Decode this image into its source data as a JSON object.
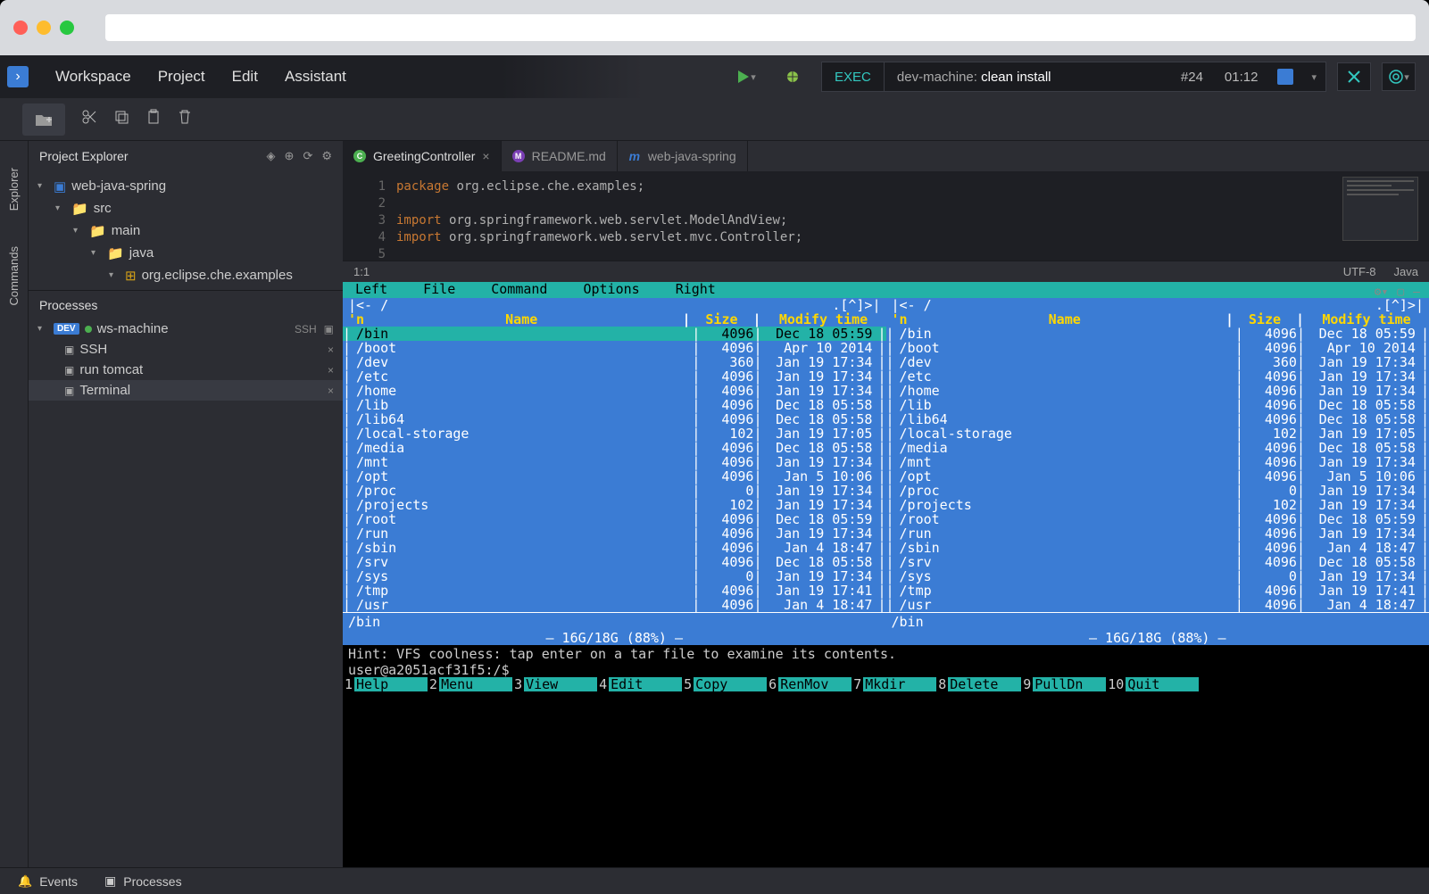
{
  "menus": {
    "workspace": "Workspace",
    "project": "Project",
    "edit": "Edit",
    "assistant": "Assistant"
  },
  "exec": {
    "label": "EXEC",
    "prefix": "dev-machine: ",
    "cmd": "clean install",
    "job": "#24",
    "time": "01:12"
  },
  "explorer": {
    "title": "Project Explorer",
    "root": "web-java-spring",
    "nodes": {
      "src": "src",
      "main": "main",
      "java": "java",
      "pkg": "org.eclipse.che.examples"
    }
  },
  "rail": {
    "explorer": "Explorer",
    "commands": "Commands"
  },
  "processes": {
    "title": "Processes",
    "machine": "ws-machine",
    "ssh_label": "SSH",
    "items": {
      "ssh": "SSH",
      "tomcat": "run tomcat",
      "terminal": "Terminal"
    }
  },
  "tabs": {
    "greeting": "GreetingController",
    "readme": "README.md",
    "spring": "web-java-spring"
  },
  "code": {
    "lines": [
      "1",
      "2",
      "3",
      "4",
      "5"
    ],
    "l1_kw": "package",
    "l1_rest": " org.eclipse.che.examples;",
    "l3_kw": "import",
    "l3_rest": " org.springframework.web.servlet.ModelAndView;",
    "l4_kw": "import",
    "l4_rest": " org.springframework.web.servlet.mvc.Controller;"
  },
  "status": {
    "pos": "1:1",
    "enc": "UTF-8",
    "lang": "Java"
  },
  "mc": {
    "menu": [
      "Left",
      "File",
      "Command",
      "Options",
      "Right"
    ],
    "path": "/",
    "cols": {
      "n": "'n",
      "name": "Name",
      "size": "Size",
      "mtime": "Modify time"
    },
    "rows": [
      {
        "name": "/bin",
        "size": "4096",
        "mtime": "Dec 18 05:59"
      },
      {
        "name": "/boot",
        "size": "4096",
        "mtime": "Apr 10  2014"
      },
      {
        "name": "/dev",
        "size": "360",
        "mtime": "Jan 19 17:34"
      },
      {
        "name": "/etc",
        "size": "4096",
        "mtime": "Jan 19 17:34"
      },
      {
        "name": "/home",
        "size": "4096",
        "mtime": "Jan 19 17:34"
      },
      {
        "name": "/lib",
        "size": "4096",
        "mtime": "Dec 18 05:58"
      },
      {
        "name": "/lib64",
        "size": "4096",
        "mtime": "Dec 18 05:58"
      },
      {
        "name": "/local-storage",
        "size": "102",
        "mtime": "Jan 19 17:05"
      },
      {
        "name": "/media",
        "size": "4096",
        "mtime": "Dec 18 05:58"
      },
      {
        "name": "/mnt",
        "size": "4096",
        "mtime": "Jan 19 17:34"
      },
      {
        "name": "/opt",
        "size": "4096",
        "mtime": "Jan  5 10:06"
      },
      {
        "name": "/proc",
        "size": "0",
        "mtime": "Jan 19 17:34"
      },
      {
        "name": "/projects",
        "size": "102",
        "mtime": "Jan 19 17:34"
      },
      {
        "name": "/root",
        "size": "4096",
        "mtime": "Dec 18 05:59"
      },
      {
        "name": "/run",
        "size": "4096",
        "mtime": "Jan 19 17:34"
      },
      {
        "name": "/sbin",
        "size": "4096",
        "mtime": "Jan  4 18:47"
      },
      {
        "name": "/srv",
        "size": "4096",
        "mtime": "Dec 18 05:58"
      },
      {
        "name": "/sys",
        "size": "0",
        "mtime": "Jan 19 17:34"
      },
      {
        "name": "/tmp",
        "size": "4096",
        "mtime": "Jan 19 17:41"
      },
      {
        "name": "/usr",
        "size": "4096",
        "mtime": "Jan  4 18:47"
      }
    ],
    "selected": "/bin",
    "disk": "16G/18G (88%)",
    "hint": "Hint: VFS coolness: tap enter on a tar file to examine its contents.",
    "prompt": "user@a2051acf31f5:/$",
    "fkeys": [
      {
        "n": "1",
        "l": "Help"
      },
      {
        "n": "2",
        "l": "Menu"
      },
      {
        "n": "3",
        "l": "View"
      },
      {
        "n": "4",
        "l": "Edit"
      },
      {
        "n": "5",
        "l": "Copy"
      },
      {
        "n": "6",
        "l": "RenMov"
      },
      {
        "n": "7",
        "l": "Mkdir"
      },
      {
        "n": "8",
        "l": "Delete"
      },
      {
        "n": "9",
        "l": "PullDn"
      },
      {
        "n": "10",
        "l": "Quit"
      }
    ]
  },
  "bottom": {
    "events": "Events",
    "processes": "Processes"
  }
}
